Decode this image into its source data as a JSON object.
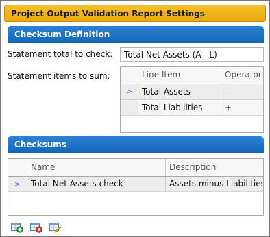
{
  "window": {
    "title": "Project Output Validation Report Settings"
  },
  "checksum_definition": {
    "header": "Checksum Definition",
    "statement_total_label": "Statement total to check:",
    "statement_total_value": "Total Net Assets (A - L)",
    "items_label": "Statement items to sum:",
    "columns": [
      "Line Item",
      "Operator"
    ],
    "rows": [
      {
        "marker": ">",
        "line_item": "Total Assets",
        "operator": "-"
      },
      {
        "marker": "",
        "line_item": "Total Liabilities",
        "operator": "+"
      }
    ]
  },
  "checksums": {
    "header": "Checksums",
    "columns": [
      "Name",
      "Description"
    ],
    "rows": [
      {
        "marker": ">",
        "name": "Total Net Assets check",
        "description": "Assets minus Liabilities"
      }
    ]
  },
  "toolbar": {
    "icons": [
      "add-checksum-icon",
      "delete-checksum-icon",
      "edit-checksum-icon"
    ]
  },
  "colors": {
    "title_bar": "#e9a90c",
    "section_header": "#1a6cc0",
    "add_accent": "#2ea043",
    "delete_accent": "#d9342b",
    "edit_accent": "#e0b020"
  }
}
